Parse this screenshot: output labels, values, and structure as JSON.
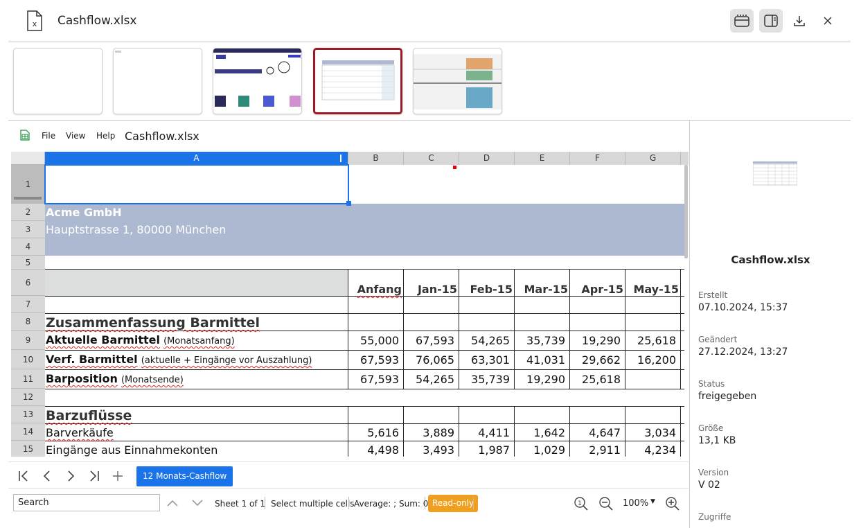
{
  "window": {
    "title": "Cashflow.xlsx"
  },
  "spreadsheet": {
    "menu": [
      "File",
      "View",
      "Help"
    ],
    "doc_title": "Cashflow.xlsx",
    "columns": [
      "A",
      "B",
      "C",
      "D",
      "E",
      "F",
      "G"
    ],
    "rows": [
      "1",
      "2",
      "3",
      "4",
      "5",
      "6",
      "7",
      "8",
      "9",
      "10",
      "11",
      "12",
      "13",
      "14",
      "15"
    ],
    "company": "Acme GmbH",
    "address": "Hauptstrasse 1, 80000 München",
    "header_row": [
      "Anfang",
      "Jan-15",
      "Feb-15",
      "Mar-15",
      "Apr-15",
      "May-15"
    ],
    "section_summary": "Zusammenfassung Barmittel",
    "row9": {
      "bold": "Aktuelle Barmittel",
      "note": "(Monatsanfang)",
      "values": [
        "55,000",
        "67,593",
        "54,265",
        "35,739",
        "19,290",
        "25,618"
      ]
    },
    "row10": {
      "bold": "Verf. Barmittel",
      "note": "(aktuelle + Eingänge vor Auszahlung)",
      "values": [
        "67,593",
        "76,065",
        "63,301",
        "41,031",
        "29,662",
        "16,200"
      ]
    },
    "row11": {
      "bold": "Barposition",
      "note": "(Monatsende)",
      "values": [
        "67,593",
        "54,265",
        "35,739",
        "19,290",
        "25,618",
        ""
      ]
    },
    "section_inflows": "Barzuflüsse",
    "row14": {
      "label": "Barverkäufe",
      "values": [
        "5,616",
        "3,889",
        "4,411",
        "1,642",
        "4,647",
        "3,034"
      ]
    },
    "row15": {
      "label": "Eingänge aus Einnahmekonten",
      "values": [
        "4,498",
        "3,493",
        "1,987",
        "1,029",
        "2,911",
        "4,234"
      ]
    },
    "sheet_tab": "12 Monats-Cashflow",
    "search_value": "Search",
    "sheet_info": "Sheet 1 of 1",
    "select_mode": "Select multiple cells",
    "stats": "Average: ; Sum: 0",
    "readonly": "Read-only",
    "zoom": "100%"
  },
  "info_panel": {
    "name": "Cashflow.xlsx",
    "fields": [
      {
        "label": "Erstellt",
        "value": "07.10.2024, 15:37"
      },
      {
        "label": "Geändert",
        "value": "27.12.2024, 13:27"
      },
      {
        "label": "Status",
        "value": "freigegeben"
      },
      {
        "label": "Größe",
        "value": "13,1 KB"
      },
      {
        "label": "Version",
        "value": "V 02"
      },
      {
        "label": "Zugriffe",
        "value": ""
      }
    ]
  },
  "colors": {
    "accent": "#1a73e8",
    "selected_thumb": "#9b1b25",
    "readonly": "#f0a020",
    "company_band": "#adb9d0"
  }
}
